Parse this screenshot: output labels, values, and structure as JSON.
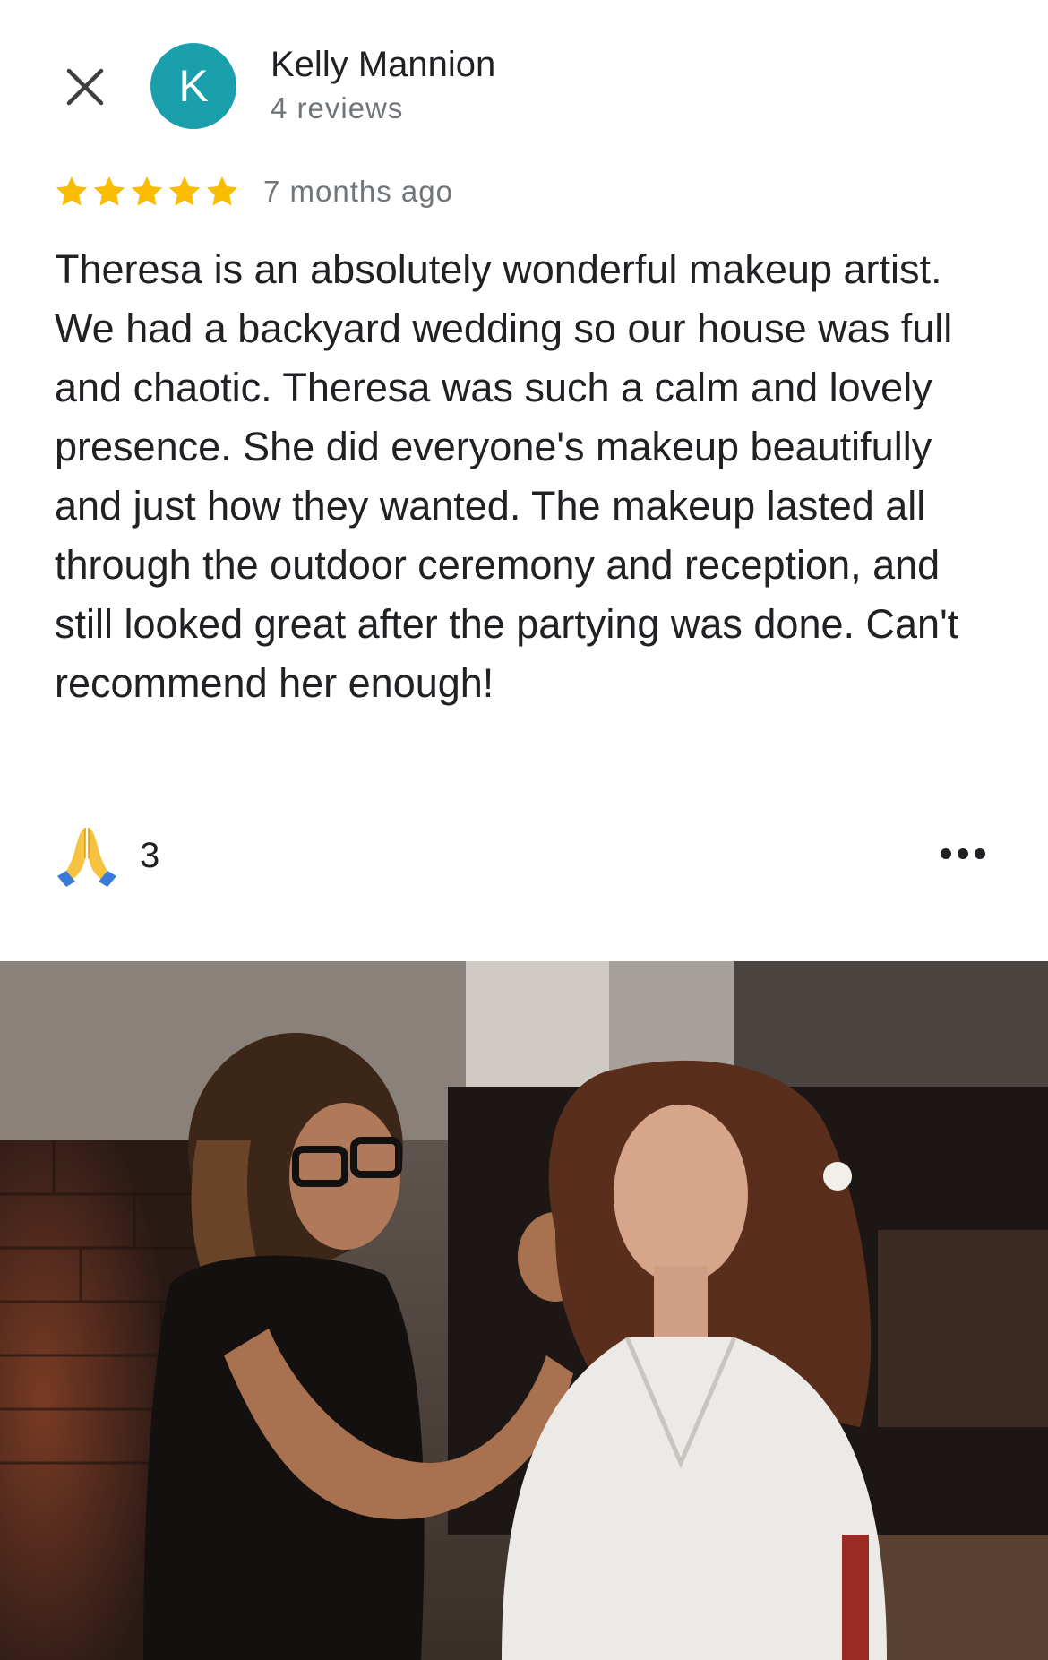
{
  "reviewer": {
    "initial": "K",
    "name": "Kelly Mannion",
    "review_count": "4 reviews",
    "avatar_color": "#1aa0ad"
  },
  "review": {
    "rating": 5,
    "time_ago": "7 months ago",
    "text": "Theresa is an absolutely wonderful makeup artist. We had a backyard wedding so our house was full and chaotic. Theresa was such a calm and lovely presence. She did everyone's makeup beautifully and just how they wanted. The makeup lasted all through the outdoor ceremony and reception, and still looked great after the partying was done. Can't recommend her enough!"
  },
  "reactions": {
    "icon": "folded-hands-icon",
    "count": "3"
  },
  "icons": {
    "close": "close-icon",
    "more": "more-options-icon",
    "star": "star-icon"
  },
  "colors": {
    "star": "#fbbc04",
    "secondary_text": "#70757a",
    "primary_text": "#202124"
  }
}
